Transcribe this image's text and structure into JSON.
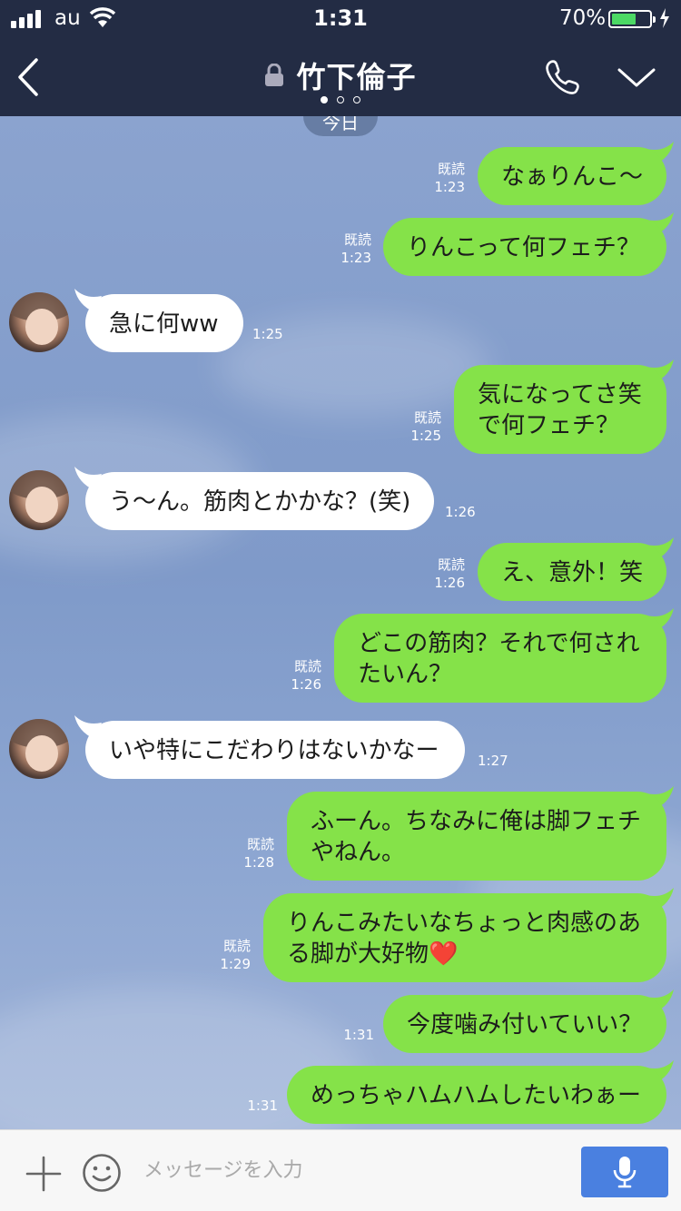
{
  "status_bar": {
    "carrier": "au",
    "time": "1:31",
    "battery": "70%",
    "battery_level": 0.7
  },
  "header": {
    "title": "竹下倫子",
    "page_dots": 3,
    "active_dot": 0
  },
  "date_pill": "今日",
  "messages": [
    {
      "dir": "out",
      "lines": [
        "なぁりんこ〜"
      ],
      "read": "既読",
      "time": "1:23"
    },
    {
      "dir": "out",
      "lines": [
        "りんこって何フェチ？"
      ],
      "read": "既読",
      "time": "1:23"
    },
    {
      "dir": "in",
      "lines": [
        "急に何ww"
      ],
      "time": "1:25"
    },
    {
      "dir": "out",
      "lines": [
        "気になってさ笑",
        "で何フェチ？"
      ],
      "read": "既読",
      "time": "1:25"
    },
    {
      "dir": "in",
      "lines": [
        "う〜ん。筋肉とかかな？(笑)"
      ],
      "time": "1:26"
    },
    {
      "dir": "out",
      "lines": [
        "え、意外！笑"
      ],
      "read": "既読",
      "time": "1:26"
    },
    {
      "dir": "out",
      "lines": [
        "どこの筋肉？それで何され",
        "たいん？"
      ],
      "read": "既読",
      "time": "1:26"
    },
    {
      "dir": "in",
      "lines": [
        "いや特にこだわりはないかなー"
      ],
      "time": "1:27"
    },
    {
      "dir": "out",
      "lines": [
        "ふーん。ちなみに俺は脚フェチ",
        "やねん。"
      ],
      "read": "既読",
      "time": "1:28"
    },
    {
      "dir": "out",
      "lines": [
        "りんこみたいなちょっと肉感のあ",
        "る脚が大好物❤️"
      ],
      "read": "既読",
      "time": "1:29"
    },
    {
      "dir": "out",
      "lines": [
        "今度噛み付いていい？"
      ],
      "read": "",
      "time": "1:31"
    },
    {
      "dir": "out",
      "lines": [
        "めっちゃハムハムしたいわぁー"
      ],
      "read": "",
      "time": "1:31"
    }
  ],
  "input": {
    "placeholder": "メッセージを入力",
    "value": ""
  },
  "icons": {
    "back": "chevron-left-icon",
    "lock": "lock-icon",
    "call": "phone-icon",
    "menu": "chevron-down-icon",
    "add": "plus-icon",
    "emoji": "smiley-icon",
    "voice": "microphone-icon"
  },
  "colors": {
    "header": "#232c44",
    "outgoing_bubble": "#85e249",
    "incoming_bubble": "#ffffff",
    "mic_button": "#4a80e0"
  }
}
